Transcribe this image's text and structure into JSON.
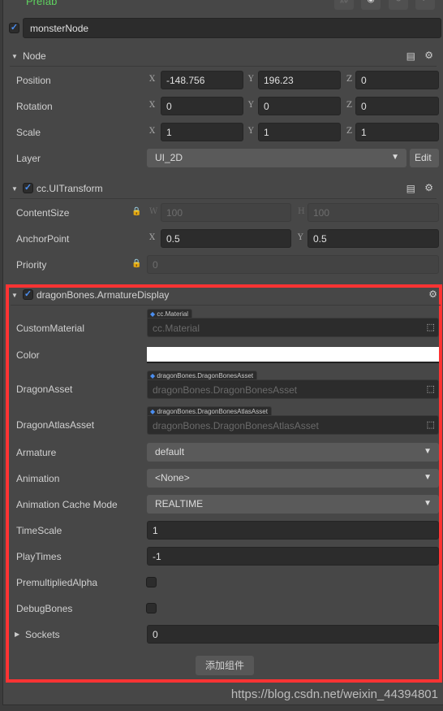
{
  "prefab_label": "Prefab",
  "toolbar_icons": [
    "unlink-icon",
    "locate-icon",
    "revert-icon",
    "apply-icon"
  ],
  "node_name": "monsterNode",
  "node": {
    "title": "Node",
    "position": {
      "label": "Position",
      "x": "-148.756",
      "y": "196.23",
      "z": "0"
    },
    "rotation": {
      "label": "Rotation",
      "x": "0",
      "y": "0",
      "z": "0"
    },
    "scale": {
      "label": "Scale",
      "x": "1",
      "y": "1",
      "z": "1"
    },
    "layer": {
      "label": "Layer",
      "value": "UI_2D",
      "edit": "Edit"
    }
  },
  "axes": {
    "x": "X",
    "y": "Y",
    "z": "Z",
    "w": "W",
    "h": "H"
  },
  "uitransform": {
    "title": "cc.UITransform",
    "content_size": {
      "label": "ContentSize",
      "w": "100",
      "h": "100"
    },
    "anchor": {
      "label": "AnchorPoint",
      "x": "0.5",
      "y": "0.5"
    },
    "priority": {
      "label": "Priority",
      "value": "0"
    }
  },
  "armature": {
    "title": "dragonBones.ArmatureDisplay",
    "custom_material": {
      "label": "CustomMaterial",
      "tag": "cc.Material",
      "placeholder": "cc.Material"
    },
    "color": {
      "label": "Color",
      "value": "#ffffff"
    },
    "dragon_asset": {
      "label": "DragonAsset",
      "tag": "dragonBones.DragonBonesAsset",
      "placeholder": "dragonBones.DragonBonesAsset"
    },
    "dragon_atlas": {
      "label": "DragonAtlasAsset",
      "tag": "dragonBones.DragonBonesAtlasAsset",
      "placeholder": "dragonBones.DragonBonesAtlasAsset"
    },
    "armature": {
      "label": "Armature",
      "value": "default"
    },
    "animation": {
      "label": "Animation",
      "value": "<None>"
    },
    "cache_mode": {
      "label": "Animation Cache Mode",
      "value": "REALTIME"
    },
    "time_scale": {
      "label": "TimeScale",
      "value": "1"
    },
    "play_times": {
      "label": "PlayTimes",
      "value": "-1"
    },
    "premult": {
      "label": "PremultipliedAlpha",
      "checked": false
    },
    "debug_bones": {
      "label": "DebugBones",
      "checked": false
    },
    "sockets": {
      "label": "Sockets",
      "value": "0"
    }
  },
  "add_component": "添加组件",
  "watermark": "https://blog.csdn.net/weixin_44394801",
  "colors": {
    "highlight": "#ff3333",
    "prefab": "#5fd35f",
    "check": "#4b8ef0"
  }
}
